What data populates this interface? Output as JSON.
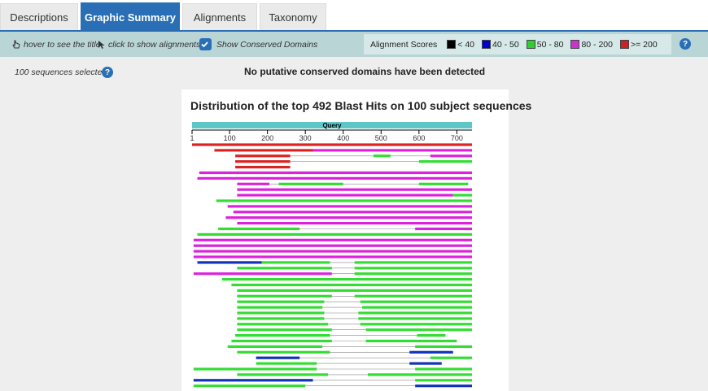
{
  "tabs": [
    {
      "label": "Descriptions",
      "active": false
    },
    {
      "label": "Graphic Summary",
      "active": true
    },
    {
      "label": "Alignments",
      "active": false
    },
    {
      "label": "Taxonomy",
      "active": false
    }
  ],
  "toolbar": {
    "hover_hint": "hover to see the title",
    "click_hint": "click to show alignments",
    "show_conserved_label": "Show Conserved Domains",
    "show_conserved_checked": true,
    "scores_label": "Alignment Scores",
    "score_legend": [
      {
        "label": "< 40",
        "color": "#000000"
      },
      {
        "label": "40 - 50",
        "color": "#0000cc"
      },
      {
        "label": "50 - 80",
        "color": "#33cc33"
      },
      {
        "label": "80 - 200",
        "color": "#cc33cc"
      },
      {
        "label": ">= 200",
        "color": "#cc2222"
      }
    ],
    "help_glyph": "?"
  },
  "status": {
    "selected": "100 sequences selected",
    "help_glyph": "?",
    "no_domains": "No putative conserved domains have been detected"
  },
  "graphic": {
    "title": "Distribution of the top 492 Blast Hits on 100 subject sequences",
    "query_label": "Query",
    "query_bar_color": "#5ec6c6",
    "ruler_ticks": [
      1,
      100,
      200,
      300,
      400,
      500,
      600,
      700
    ],
    "query_length": 740,
    "hits": [
      {
        "color": "red",
        "segments": [
          [
            1,
            740
          ]
        ]
      },
      {
        "color": "red",
        "segments": [
          [
            60,
            320
          ]
        ],
        "extra": [
          {
            "color": "magenta",
            "segments": [
              [
                320,
                740
              ]
            ]
          }
        ]
      },
      {
        "color": "red",
        "segments": [
          [
            115,
            260
          ]
        ],
        "extra": [
          {
            "color": "green",
            "segments": [
              [
                480,
                525
              ]
            ]
          },
          {
            "color": "magenta",
            "segments": [
              [
                630,
                740
              ]
            ]
          }
        ]
      },
      {
        "color": "red",
        "segments": [
          [
            115,
            260
          ]
        ],
        "extra": [
          {
            "color": "green",
            "segments": [
              [
                600,
                740
              ]
            ]
          }
        ]
      },
      {
        "color": "red",
        "segments": [
          [
            115,
            260
          ]
        ]
      },
      {
        "color": "magenta",
        "segments": [
          [
            20,
            740
          ]
        ]
      },
      {
        "color": "magenta",
        "segments": [
          [
            15,
            740
          ]
        ]
      },
      {
        "color": "magenta",
        "segments": [
          [
            120,
            205
          ]
        ],
        "extra": [
          {
            "color": "green",
            "segments": [
              [
                230,
                400
              ]
            ]
          },
          {
            "color": "green",
            "segments": [
              [
                600,
                730
              ]
            ]
          }
        ]
      },
      {
        "color": "magenta",
        "segments": [
          [
            120,
            740
          ]
        ]
      },
      {
        "color": "magenta",
        "segments": [
          [
            120,
            690
          ]
        ],
        "extra": [
          {
            "color": "green",
            "segments": [
              [
                690,
                740
              ]
            ]
          }
        ]
      },
      {
        "color": "green",
        "segments": [
          [
            65,
            740
          ]
        ]
      },
      {
        "color": "magenta",
        "segments": [
          [
            95,
            740
          ]
        ]
      },
      {
        "color": "magenta",
        "segments": [
          [
            110,
            740
          ]
        ]
      },
      {
        "color": "magenta",
        "segments": [
          [
            90,
            740
          ]
        ]
      },
      {
        "color": "magenta",
        "segments": [
          [
            120,
            740
          ]
        ]
      },
      {
        "color": "green",
        "segments": [
          [
            70,
            285
          ]
        ],
        "extra": [
          {
            "color": "magenta",
            "segments": [
              [
                590,
                740
              ]
            ]
          }
        ]
      },
      {
        "color": "green",
        "segments": [
          [
            15,
            740
          ]
        ]
      },
      {
        "color": "magenta",
        "segments": [
          [
            5,
            740
          ]
        ]
      },
      {
        "color": "magenta",
        "segments": [
          [
            5,
            740
          ]
        ]
      },
      {
        "color": "magenta",
        "segments": [
          [
            5,
            740
          ]
        ]
      },
      {
        "color": "magenta",
        "segments": [
          [
            5,
            740
          ]
        ]
      },
      {
        "color": "blue",
        "segments": [
          [
            15,
            185
          ]
        ],
        "extra": [
          {
            "color": "green",
            "segments": [
              [
                185,
                365
              ]
            ]
          },
          {
            "color": "green",
            "segments": [
              [
                430,
                740
              ]
            ]
          }
        ]
      },
      {
        "color": "green",
        "segments": [
          [
            120,
            370
          ]
        ],
        "extra": [
          {
            "color": "green",
            "segments": [
              [
                430,
                740
              ]
            ]
          }
        ]
      },
      {
        "color": "magenta",
        "segments": [
          [
            5,
            370
          ]
        ],
        "extra": [
          {
            "color": "green",
            "segments": [
              [
                430,
                740
              ]
            ]
          }
        ]
      },
      {
        "color": "green",
        "segments": [
          [
            80,
            740
          ]
        ]
      },
      {
        "color": "green",
        "segments": [
          [
            105,
            740
          ]
        ]
      },
      {
        "color": "green",
        "segments": [
          [
            120,
            740
          ]
        ]
      },
      {
        "color": "green",
        "segments": [
          [
            120,
            370
          ]
        ],
        "extra": [
          {
            "color": "green",
            "segments": [
              [
                430,
                740
              ]
            ]
          }
        ]
      },
      {
        "color": "green",
        "segments": [
          [
            120,
            350
          ]
        ],
        "extra": [
          {
            "color": "green",
            "segments": [
              [
                445,
                740
              ]
            ]
          }
        ]
      },
      {
        "color": "green",
        "segments": [
          [
            120,
            345
          ]
        ],
        "extra": [
          {
            "color": "green",
            "segments": [
              [
                450,
                740
              ]
            ]
          }
        ]
      },
      {
        "color": "green",
        "segments": [
          [
            120,
            350
          ]
        ],
        "extra": [
          {
            "color": "green",
            "segments": [
              [
                440,
                740
              ]
            ]
          }
        ]
      },
      {
        "color": "green",
        "segments": [
          [
            120,
            350
          ]
        ],
        "extra": [
          {
            "color": "green",
            "segments": [
              [
                440,
                740
              ]
            ]
          }
        ]
      },
      {
        "color": "green",
        "segments": [
          [
            120,
            360
          ]
        ],
        "extra": [
          {
            "color": "green",
            "segments": [
              [
                445,
                740
              ]
            ]
          }
        ]
      },
      {
        "color": "green",
        "segments": [
          [
            120,
            370
          ]
        ],
        "extra": [
          {
            "color": "green",
            "segments": [
              [
                460,
                740
              ]
            ]
          }
        ]
      },
      {
        "color": "green",
        "segments": [
          [
            115,
            365
          ]
        ],
        "extra": [
          {
            "color": "green",
            "segments": [
              [
                595,
                670
              ]
            ]
          }
        ]
      },
      {
        "color": "green",
        "segments": [
          [
            105,
            370
          ]
        ],
        "extra": [
          {
            "color": "green",
            "segments": [
              [
                460,
                700
              ]
            ]
          }
        ]
      },
      {
        "color": "green",
        "segments": [
          [
            95,
            345
          ]
        ],
        "extra": [
          {
            "color": "green",
            "segments": [
              [
                590,
                740
              ]
            ]
          }
        ]
      },
      {
        "color": "green",
        "segments": [
          [
            120,
            365
          ]
        ],
        "extra": [
          {
            "color": "blue",
            "segments": [
              [
                575,
                690
              ]
            ]
          }
        ]
      },
      {
        "color": "blue",
        "segments": [
          [
            170,
            285
          ]
        ],
        "extra": [
          {
            "color": "green",
            "segments": [
              [
                630,
                740
              ]
            ]
          }
        ]
      },
      {
        "color": "green",
        "segments": [
          [
            170,
            330
          ]
        ],
        "extra": [
          {
            "color": "blue",
            "segments": [
              [
                575,
                660
              ]
            ]
          }
        ]
      },
      {
        "color": "green",
        "segments": [
          [
            5,
            330
          ]
        ],
        "extra": [
          {
            "color": "green",
            "segments": [
              [
                590,
                740
              ]
            ]
          }
        ]
      },
      {
        "color": "green",
        "segments": [
          [
            120,
            360
          ]
        ],
        "extra": [
          {
            "color": "green",
            "segments": [
              [
                465,
                740
              ]
            ]
          }
        ]
      },
      {
        "color": "blue",
        "segments": [
          [
            5,
            320
          ]
        ],
        "extra": [
          {
            "color": "green",
            "segments": [
              [
                590,
                740
              ]
            ]
          }
        ]
      },
      {
        "color": "green",
        "segments": [
          [
            5,
            300
          ]
        ],
        "extra": [
          {
            "color": "blue",
            "segments": [
              [
                590,
                740
              ]
            ]
          }
        ]
      }
    ]
  }
}
